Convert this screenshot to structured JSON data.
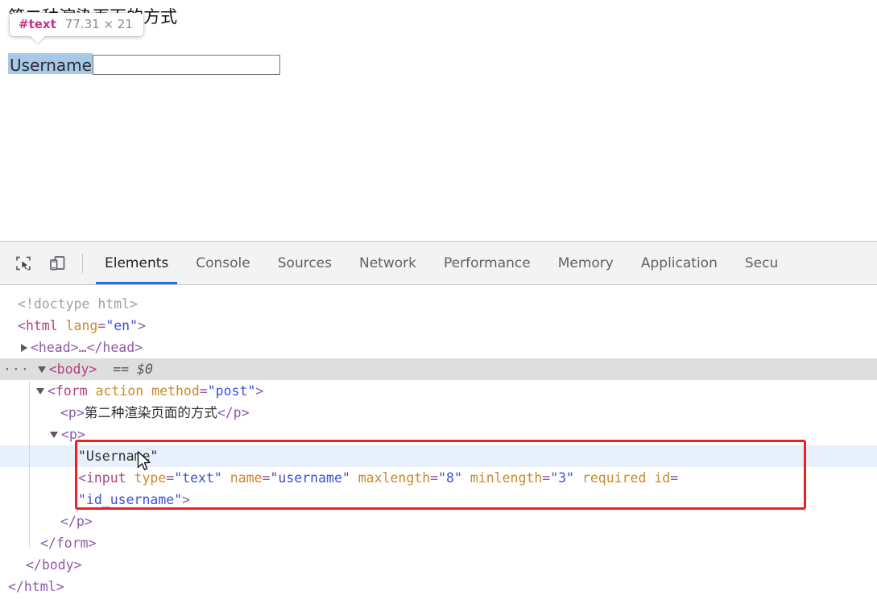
{
  "page": {
    "paragraph_text": "第二种渲染页面的方式",
    "label_text": "Username",
    "input_value": "",
    "input_placeholder": ""
  },
  "inspector_tooltip": {
    "node_name": "#text",
    "dimensions": "77.31 × 21",
    "node_name_color": "#ca338d",
    "dimensions_color": "#8a8a8a"
  },
  "devtools": {
    "toolbar": {
      "inspect_icon": "inspect-element-icon",
      "device_icon": "device-toolbar-icon"
    },
    "tabs": [
      {
        "label": "Elements",
        "active": true
      },
      {
        "label": "Console",
        "active": false
      },
      {
        "label": "Sources",
        "active": false
      },
      {
        "label": "Network",
        "active": false
      },
      {
        "label": "Performance",
        "active": false
      },
      {
        "label": "Memory",
        "active": false
      },
      {
        "label": "Application",
        "active": false
      },
      {
        "label": "Secu",
        "active": false
      }
    ],
    "active_tab_underline_color": "#1a73e8",
    "dom_tree": {
      "doctype": "<!doctype html>",
      "html_open_punct_lt": "<",
      "html_tagname": "html",
      "html_attr_name": "lang",
      "html_attr_value": "\"en\"",
      "html_open_punct_gt": ">",
      "head_collapsed": "<head>…</head>",
      "body_open": "<body>",
      "body_selected_marker": "== $0",
      "ellipsis_badge": "···",
      "form_lt": "<",
      "form_tag": "form",
      "form_attr1": "action",
      "form_attr2_name": "method",
      "form_attr2_value": "\"post\"",
      "form_gt": ">",
      "p1_open": "<p>",
      "p1_text": "第二种渲染页面的方式",
      "p1_close": "</p>",
      "p2_open": "<p>",
      "text_node": "\"Username\"",
      "input_lt": "<",
      "input_tag": "input",
      "input_attr_type_name": "type",
      "input_attr_type_value": "\"text\"",
      "input_attr_name_name": "name",
      "input_attr_name_value": "\"username\"",
      "input_attr_maxlength_name": "maxlength",
      "input_attr_maxlength_value": "\"8\"",
      "input_attr_minlength_name": "minlength",
      "input_attr_minlength_value": "\"3\"",
      "input_attr_required": "required",
      "input_attr_id_name": "id",
      "input_attr_id_value": "\"id_username\"",
      "input_gt": ">",
      "p2_close": "</p>",
      "form_close": "</form>",
      "body_close": "</body>",
      "html_close": "</html>"
    },
    "annotation": {
      "highlight_color": "#f02020"
    }
  }
}
